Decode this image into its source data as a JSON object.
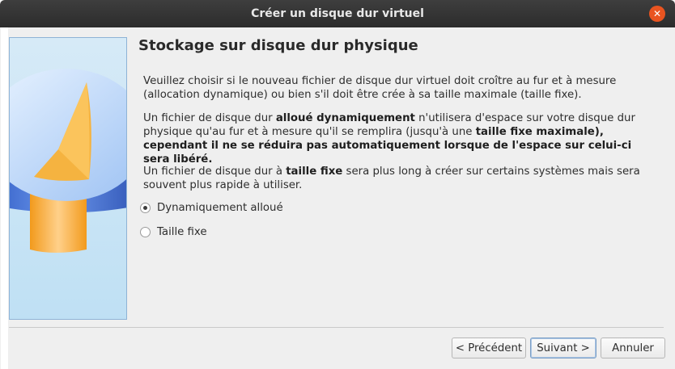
{
  "window": {
    "title": "Créer un disque dur virtuel",
    "close_glyph": "✕"
  },
  "page": {
    "heading": "Stockage sur disque dur physique",
    "intro": "Veuillez choisir si le nouveau fichier de disque dur virtuel doit croître au fur et à mesure (allocation dynamique) ou bien s'il doit être crée à sa taille maximale (taille fixe).",
    "dynamic_desc": {
      "part1": "Un fichier de disque dur ",
      "bold1": "alloué dynamiquement",
      "part2": " n'utilisera d'espace sur votre disque dur physique qu'au fur et à mesure qu'il se remplira (jusqu'à une ",
      "bold2": "taille fixe maximale), cependant il ne se réduira pas automatiquement lorsque de l'espace sur celui-ci sera libéré."
    },
    "fixed_desc": {
      "part1": "Un fichier de disque dur à ",
      "bold1": "taille fixe",
      "part2": " sera plus long à créer sur certains systèmes mais sera souvent plus rapide à utiliser."
    },
    "options": [
      {
        "label": "Dynamiquement alloué",
        "checked": true
      },
      {
        "label": "Taille fixe",
        "checked": false
      }
    ]
  },
  "buttons": {
    "previous": "< Précédent",
    "next": "Suivant >",
    "cancel": "Annuler"
  },
  "colors": {
    "accent_close": "#e95420",
    "disk_blue": "#3f6fd8",
    "disk_orange": "#f5a623"
  }
}
